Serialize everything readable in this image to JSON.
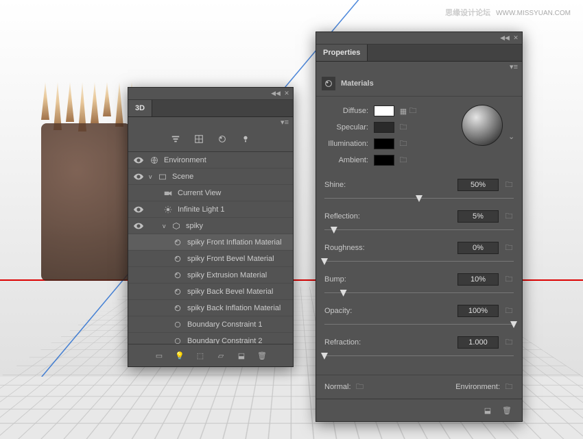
{
  "watermark": {
    "text": "思缘设计论坛",
    "url": "WWW.MISSYUAN.COM"
  },
  "panel3d": {
    "title": "3D",
    "items": [
      {
        "label": "Environment",
        "icon": "env",
        "indent": 0,
        "eye": true
      },
      {
        "label": "Scene",
        "icon": "scene",
        "indent": 0,
        "eye": true,
        "chev": "v"
      },
      {
        "label": "Current View",
        "icon": "camera",
        "indent": 1
      },
      {
        "label": "Infinite Light 1",
        "icon": "light",
        "indent": 1,
        "eye": true
      },
      {
        "label": "spiky",
        "icon": "mesh",
        "indent": 1,
        "eye": true,
        "chev": "v"
      },
      {
        "label": "spiky Front Inflation Material",
        "icon": "mat",
        "indent": 2,
        "sel": true
      },
      {
        "label": "spiky Front Bevel Material",
        "icon": "mat",
        "indent": 2
      },
      {
        "label": "spiky Extrusion Material",
        "icon": "mat",
        "indent": 2
      },
      {
        "label": "spiky Back Bevel Material",
        "icon": "mat",
        "indent": 2
      },
      {
        "label": "spiky Back Inflation Material",
        "icon": "mat",
        "indent": 2
      },
      {
        "label": "Boundary Constraint 1",
        "icon": "constraint",
        "indent": 2
      },
      {
        "label": "Boundary Constraint 2",
        "icon": "constraint",
        "indent": 2
      }
    ]
  },
  "props": {
    "title": "Properties",
    "subtitle": "Materials",
    "swatches": {
      "diffuse": {
        "label": "Diffuse:",
        "color": "#ffffff"
      },
      "specular": {
        "label": "Specular:",
        "color": "#2a2a2a"
      },
      "illumination": {
        "label": "Illumination:",
        "color": "#000000"
      },
      "ambient": {
        "label": "Ambient:",
        "color": "#000000"
      }
    },
    "sliders": {
      "shine": {
        "label": "Shine:",
        "value": "50%",
        "pos": 50
      },
      "reflection": {
        "label": "Reflection:",
        "value": "5%",
        "pos": 5
      },
      "roughness": {
        "label": "Roughness:",
        "value": "0%",
        "pos": 0
      },
      "bump": {
        "label": "Bump:",
        "value": "10%",
        "pos": 10
      },
      "opacity": {
        "label": "Opacity:",
        "value": "100%",
        "pos": 100
      },
      "refraction": {
        "label": "Refraction:",
        "value": "1.000",
        "pos": 0
      }
    },
    "bottom": {
      "normal": "Normal:",
      "environment": "Environment:"
    }
  }
}
